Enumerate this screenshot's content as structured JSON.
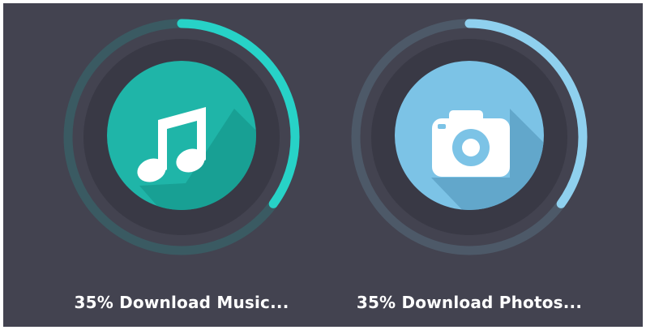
{
  "downloads": [
    {
      "id": "music",
      "percent": "35%",
      "progress": 0.35,
      "label": "Download Music...",
      "icon": "music-note-icon",
      "colors": {
        "accent": "#27d2c7",
        "track": "#3a5a62",
        "inner_circle": "#1fb5a8",
        "shadow": "#189c90"
      }
    },
    {
      "id": "photos",
      "percent": "35%",
      "progress": 0.35,
      "label": "Download Photos...",
      "icon": "camera-icon",
      "colors": {
        "accent": "#8fd0ee",
        "track": "#4d5968",
        "inner_circle": "#7cc3e6",
        "shadow": "#5ea2c6"
      }
    }
  ],
  "colors": {
    "background": "#434350",
    "inner_disc": "#393945"
  }
}
